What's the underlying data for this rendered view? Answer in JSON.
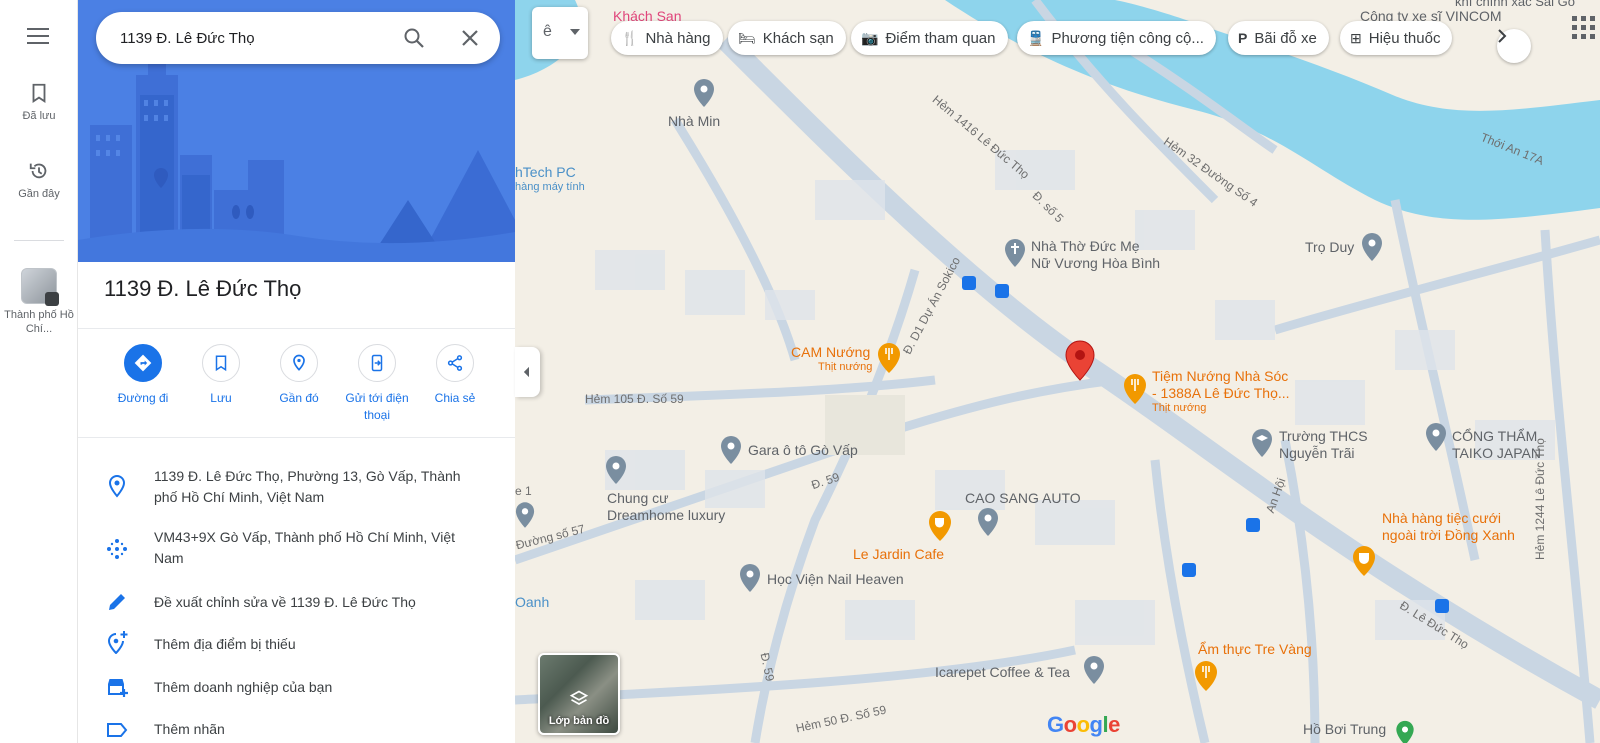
{
  "rail": {
    "saved_label": "Đã lưu",
    "recent_label": "Gần đây",
    "recent_place_label": "Thành phố Hồ Chí..."
  },
  "search": {
    "value": "1139 Đ. Lê Đức Thọ"
  },
  "place": {
    "title": "1139 Đ. Lê Đức Thọ"
  },
  "actions": [
    {
      "label": "Đường đi",
      "icon": "directions-icon"
    },
    {
      "label": "Lưu",
      "icon": "bookmark-icon"
    },
    {
      "label": "Gần đó",
      "icon": "nearby-icon"
    },
    {
      "label": "Gửi tới điện thoại",
      "icon": "send-to-phone-icon"
    },
    {
      "label": "Chia sẻ",
      "icon": "share-icon"
    }
  ],
  "info": {
    "address": "1139 Đ. Lê Đức Thọ, Phường 13, Gò Vấp, Thành phố Hồ Chí Minh, Việt Nam",
    "plus_code": "VM43+9X Gò Vấp, Thành phố Hồ Chí Minh, Việt Nam",
    "suggest_edit": "Đề xuất chỉnh sửa về 1139 Đ. Lê Đức Thọ",
    "add_missing": "Thêm địa điểm bị thiếu",
    "add_business": "Thêm doanh nghiệp của bạn",
    "add_label": "Thêm nhãn"
  },
  "chips": {
    "translate": "ê",
    "restaurants": "Nhà hàng",
    "hotels": "Khách sạn",
    "attractions": "Điểm tham quan",
    "transit": "Phương tiện công cộ...",
    "parking": "Bãi đỗ xe",
    "pharmacy": "Hiệu thuốc"
  },
  "layers": {
    "label": "Lớp bản đồ"
  },
  "map_labels": {
    "khach_san": "Khách San",
    "cong_ty": "Công ty xe sĩ VINCOM",
    "khi_chinh": "khí chính xác Sai Gò",
    "nha_min": "Nhà Min",
    "htech": "hTech PC",
    "htech_sub": "hàng máy tính",
    "hem1416": "Hẻm 1416 Lê Đức Thọ",
    "hem32": "Hẻm 32 Đường Số 4",
    "thoi_an": "Thới An 17A",
    "d_so_5": "Đ. số 5",
    "nha_tho_1": "Nhà Thờ Đức Mẹ",
    "nha_tho_2": "Nữ Vương Hòa Bình",
    "tro_duy": "Trọ Duy",
    "cam_nuong": "CAM Nướng",
    "cam_nuong_sub": "Thịt nướng",
    "d1_sokico": "Đ. D1 Dự Án Sokico",
    "tiem_1": "Tiệm Nướng Nhà Sóc",
    "tiem_2": "- 1388A Lê Đức Thọ...",
    "tiem_sub": "Thịt nướng",
    "hem105": "Hẻm 105 Đ. Số 59",
    "gara": "Gara ô tô Gò Vấp",
    "truong_1": "Trường THCS",
    "truong_2": "Nguyễn Trãi",
    "cong_tham_1": "CỔNG THẨM",
    "cong_tham_2": "TAIKO JAPAN",
    "d59": "Đ. 59",
    "e1": "e 1",
    "chung_cu_1": "Chung cư",
    "chung_cu_2": "Dreamhome luxury",
    "cao_sang": "CAO SANG AUTO",
    "an_hoi": "An Hội",
    "nha_hang_1": "Nhà hàng tiệc cưới",
    "nha_hang_2": "ngoài trời Đồng Xanh",
    "duong57": "Đường số 57",
    "le_jardin": "Le Jardin Cafe",
    "hoc_vien": "Học Viện Nail Heaven",
    "oanh": "Oanh",
    "hem1244": "Hẻm 1244 Lê Đức Thọ",
    "d_le_duc_tho": "Đ. Lê Đức Thọ",
    "d59_vert": "Đ. 59",
    "am_thuc": "Ẩm thực Tre Vàng",
    "icarepet": "Icarepet Coffee & Tea",
    "hem50": "Hẻm 50 Đ. Số 59",
    "ho_boi": "Hồ Bơi Trung",
    "google": "Google"
  },
  "colors": {
    "accent": "#1a73e8",
    "pin": "#ea4335",
    "water": "#8ed4ec",
    "land": "#f3efe6",
    "road": "#c9d6e3"
  }
}
